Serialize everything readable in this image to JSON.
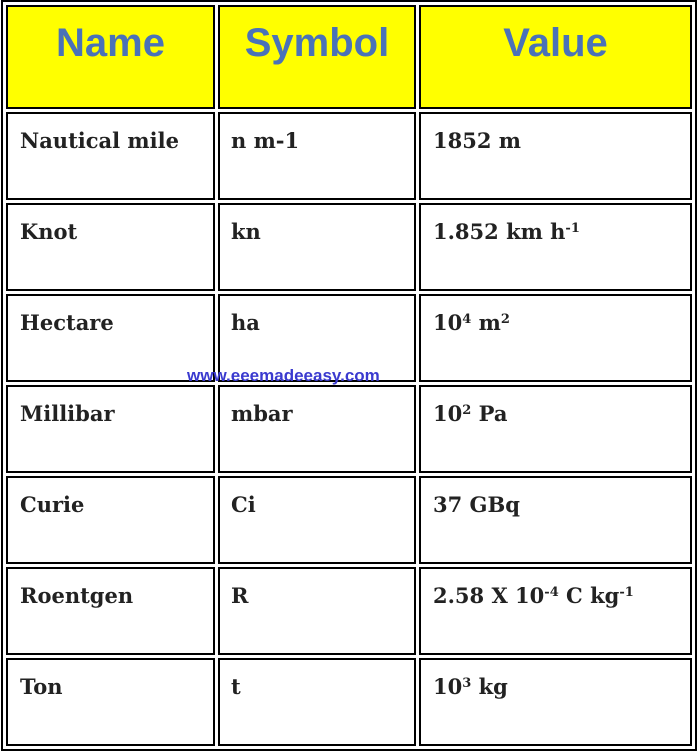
{
  "table": {
    "header_bg": "#ffff00",
    "header_color": "#4a72b8",
    "headers": [
      "Name",
      "Symbol",
      "Value"
    ],
    "rows": [
      {
        "name": "Nautical mile",
        "symbol": "n m-1",
        "value": {
          "base": "1852 m",
          "parts": []
        }
      },
      {
        "name": "Knot",
        "symbol": "kn",
        "value": {
          "base": "1.852 km h",
          "parts": [
            {
              "sup": "-1"
            }
          ]
        }
      },
      {
        "name": "Hectare",
        "symbol": "ha",
        "value": {
          "base": "10",
          "parts": [
            {
              "sup": "4"
            },
            {
              "text": " m"
            },
            {
              "sup": "2"
            }
          ]
        }
      },
      {
        "name": "Millibar",
        "symbol": "mbar",
        "value": {
          "base": "10",
          "parts": [
            {
              "sup": "2"
            },
            {
              "text": " Pa"
            }
          ]
        }
      },
      {
        "name": "Curie",
        "symbol": "Ci",
        "value": {
          "base": "37 GBq",
          "parts": []
        }
      },
      {
        "name": "Roentgen",
        "symbol": "R",
        "value": {
          "base": "2.58 X 10",
          "parts": [
            {
              "sup": "-4"
            },
            {
              "text": " C kg"
            },
            {
              "sup": "-1"
            }
          ]
        }
      },
      {
        "name": "Ton",
        "symbol": "t",
        "value": {
          "base": "10",
          "parts": [
            {
              "sup": "3"
            },
            {
              "text": " kg"
            }
          ]
        }
      }
    ]
  },
  "watermark": {
    "text": "www.eeemadeeasy.com",
    "color": "#3a3acf"
  }
}
